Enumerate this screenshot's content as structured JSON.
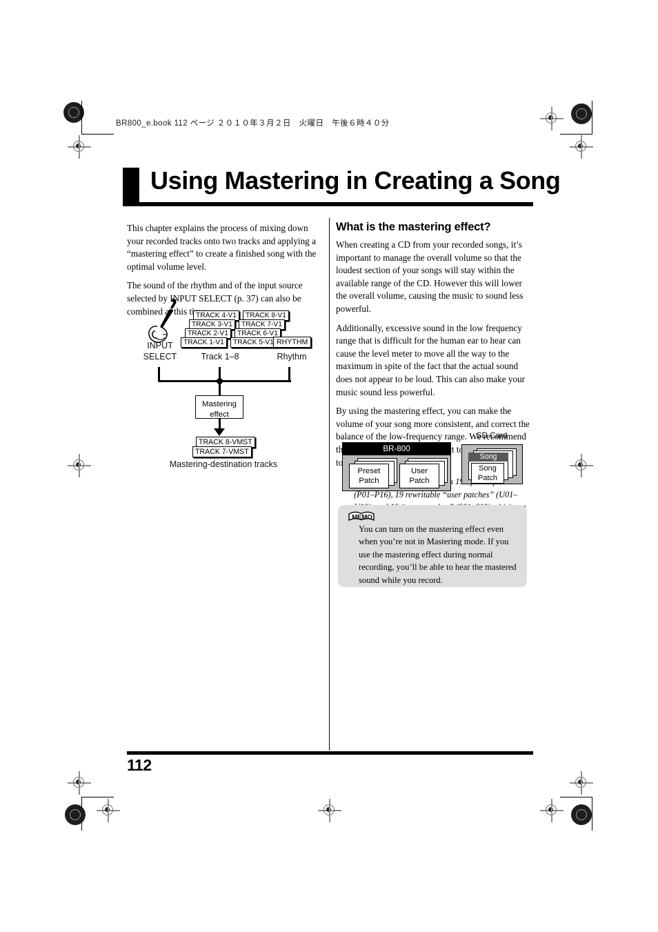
{
  "print": {
    "job_line": "BR800_e.book  112 ページ  ２０１０年３月２日　火曜日　午後６時４０分"
  },
  "title": "Using Mastering in Creating a Song",
  "left_column": {
    "paragraphs": [
      "This chapter explains the process of mixing down your recorded tracks onto two tracks and applying a “mastering effect” to create a finished song with the optimal volume level.",
      "The sound of the rhythm and of the input source selected by INPUT SELECT (p. 37) can also be combined at this time."
    ]
  },
  "diagram": {
    "input_select_label": "INPUT\nSELECT",
    "input_select_line1": "INPUT",
    "input_select_line2": "SELECT",
    "track_group_label": "Track 1–8",
    "rhythm_label": "Rhythm",
    "rhythm_box": "RHYTHM",
    "tracks_left": [
      "TRACK 1-V1",
      "TRACK 2-V1",
      "TRACK 3-V1",
      "TRACK 4-V1"
    ],
    "tracks_right": [
      "TRACK 5-V1",
      "TRACK 6-V1",
      "TRACK 7-V1",
      "TRACK 8-V1"
    ],
    "mastering_box_line1": "Mastering",
    "mastering_box_line2": "effect",
    "dest_top": "TRACK 8-VMST",
    "dest_bottom": "TRACK 7-VMST",
    "dest_caption": "Mastering-destination tracks"
  },
  "right_column": {
    "heading": "What is the mastering effect?",
    "paragraphs": [
      "When creating a CD from your recorded songs, it’s important to manage the overall volume so that the loudest section of your songs will stay within the available range of the CD. However this will lower the overall volume, causing the music to sound less powerful.",
      "Additionally, excessive sound in the low frequency range that is difficult for the human ear to hear can cause the level meter to move all the way to the maximum in spite of the fact that the actual sound does not appear to be loud. This can also make your music sound less powerful.",
      "By using the mastering effect, you can make the volume of your song more consistent, and correct the balance of the low-frequency range. We recommend that you use the mastering effect to add the final touch to your song."
    ],
    "footnote_marker": "*",
    "footnote": "The mastering effect provides 19 “preset patches” (P01–P16), 19 rewritable “user patches” (U01–U19), and 19 “song patches” (S01–S19) which are stored for each song."
  },
  "patch_diagram": {
    "device_label": "BR-800",
    "preset_patch_line1": "Preset",
    "preset_patch_line2": "Patch",
    "user_patch_line1": "User",
    "user_patch_line2": "Patch",
    "sd_card_label": "SD Card",
    "song_label": "Song",
    "song_patch_line1": "Song",
    "song_patch_line2": "Patch"
  },
  "memo": {
    "icon_label": "MEMO",
    "text": "You can turn on the mastering effect even when you’re not in Mastering mode. If you use the mastering effect during normal recording, you’ll be able to hear the mastered sound while you record."
  },
  "footer": {
    "page_number": "112"
  },
  "colors": {
    "ink": "#000000",
    "page": "#ffffff",
    "memo_bg": "#dedede",
    "device_bg": "#b9b9b9",
    "song_header": "#585858"
  }
}
